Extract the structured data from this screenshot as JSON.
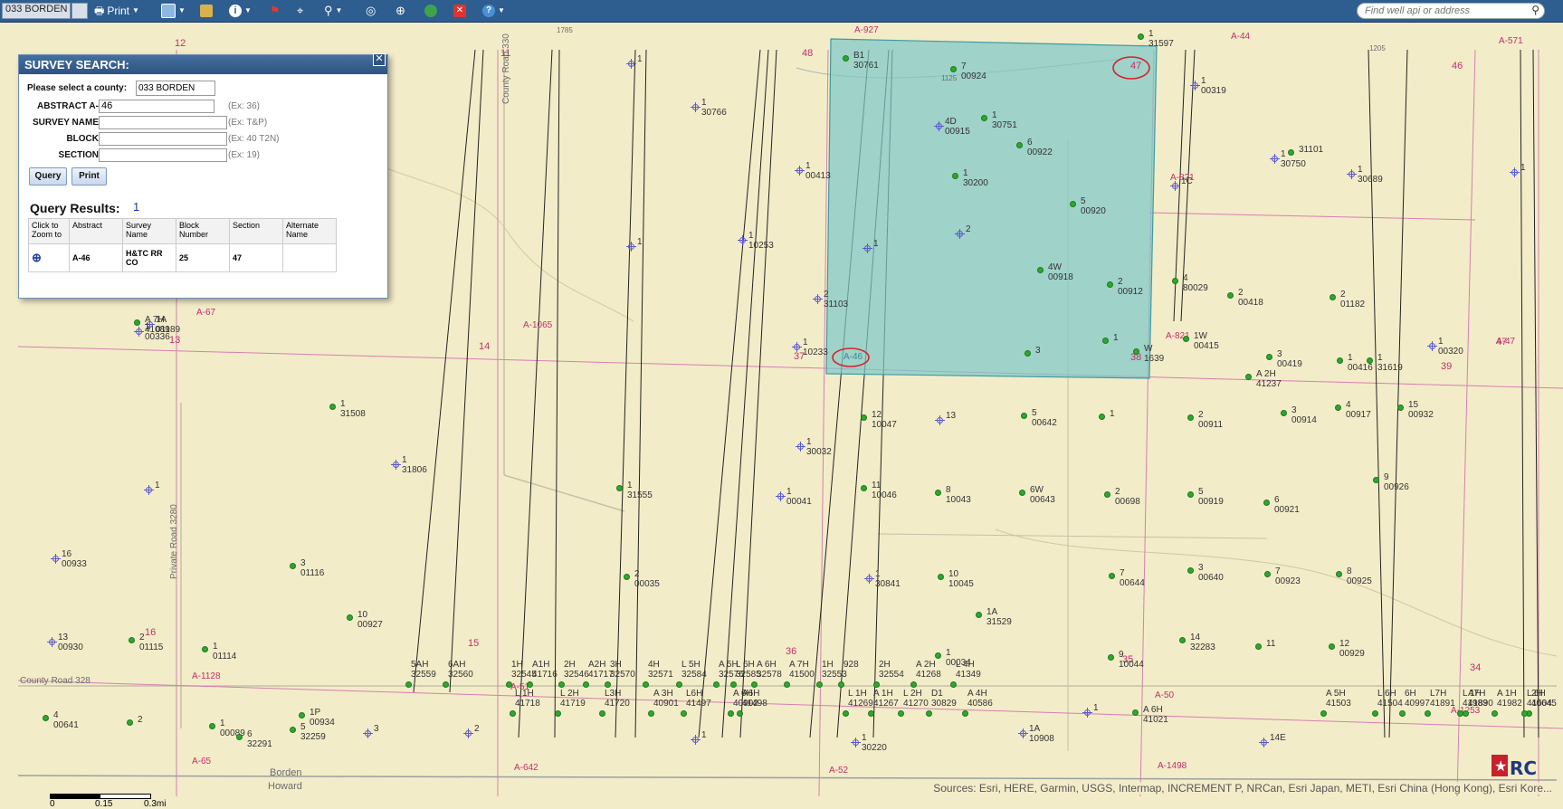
{
  "toolbar": {
    "county_label": "033 BORDEN",
    "print_label": "Print",
    "search_placeholder": "Find well api or address"
  },
  "panel": {
    "title": "SURVEY SEARCH:",
    "county_prompt": "Please select a county:",
    "county_value": "033 BORDEN",
    "fields": [
      {
        "label": "ABSTRACT A-",
        "value": "46",
        "example": "(Ex: 36)"
      },
      {
        "label": "SURVEY NAME",
        "value": "",
        "example": "(Ex: T&P)"
      },
      {
        "label": "BLOCK",
        "value": "",
        "example": "(Ex: 40 T2N)"
      },
      {
        "label": "SECTION",
        "value": "",
        "example": "(Ex: 19)"
      }
    ],
    "query_button": "Query",
    "print_button": "Print",
    "results_title": "Query Results:",
    "results_count": "1",
    "columns": [
      "Click to Zoom to",
      "Abstract",
      "Survey Name",
      "Block Number",
      "Section",
      "Alternate Name"
    ],
    "rows": [
      {
        "abstract": "A-46",
        "survey_name": "H&TC RR CO",
        "block": "25",
        "section": "47",
        "alternate": ""
      }
    ]
  },
  "map": {
    "highlight_color": "#7ec8c8",
    "road_labels": [
      "County Road 330",
      "Private Road 3280",
      "County Road 328",
      "1785",
      "1205",
      "1125"
    ],
    "county_labels": [
      "Borden",
      "Howard"
    ],
    "section_numbers": [
      "12",
      "11",
      "48",
      "46",
      "13",
      "14",
      "37",
      "38",
      "47",
      "39",
      "16",
      "15",
      "36",
      "35",
      "34",
      "47"
    ],
    "abstracts": [
      "A-927",
      "A-44",
      "A-571",
      "A-67",
      "A-1065",
      "A-821",
      "A-821",
      "A-47",
      "A-1128",
      "A-51",
      "A-50",
      "A-1253",
      "A-65",
      "A-642",
      "A-52",
      "A-1498",
      "A-46"
    ],
    "wells": [
      {
        "t": "x",
        "l": "1"
      },
      {
        "t": "x",
        "l": "1\n30766"
      },
      {
        "t": "x",
        "l": "1\n00413"
      },
      {
        "t": "x",
        "l": "1"
      },
      {
        "t": "x",
        "l": "1\n10253"
      },
      {
        "t": "x",
        "l": "2\n31103"
      },
      {
        "t": "x",
        "l": "1\n10233"
      },
      {
        "t": "d",
        "l": "B1\n30761"
      },
      {
        "t": "d",
        "l": "7\n00924"
      },
      {
        "t": "x",
        "l": "4D\n00915"
      },
      {
        "t": "d",
        "l": "1\n30751"
      },
      {
        "t": "d",
        "l": "6\n00922"
      },
      {
        "t": "d",
        "l": "1\n30200"
      },
      {
        "t": "d",
        "l": "5\n00920"
      },
      {
        "t": "x",
        "l": "2"
      },
      {
        "t": "x",
        "l": "1"
      },
      {
        "t": "d",
        "l": "4W\n00918"
      },
      {
        "t": "d",
        "l": "2\n00912"
      },
      {
        "t": "d",
        "l": "3"
      },
      {
        "t": "d",
        "l": "1"
      },
      {
        "t": "d",
        "l": "1\n31597"
      },
      {
        "t": "x",
        "l": "1\n00319"
      },
      {
        "t": "x",
        "l": "1\n30750"
      },
      {
        "t": "d",
        "l": "31101"
      },
      {
        "t": "x",
        "l": "1\n30689"
      },
      {
        "t": "x",
        "l": "1"
      },
      {
        "t": "x",
        "l": "1C"
      },
      {
        "t": "d",
        "l": "4\n80029"
      },
      {
        "t": "d",
        "l": "2\n00418"
      },
      {
        "t": "d",
        "l": "2\n01182"
      },
      {
        "t": "d",
        "l": "1W\n00415"
      },
      {
        "t": "d",
        "l": "W\n1639"
      },
      {
        "t": "d",
        "l": "3\n00419"
      },
      {
        "t": "d",
        "l": "1\n00416"
      },
      {
        "t": "d",
        "l": "1\n31619"
      },
      {
        "t": "x",
        "l": "1\n00320"
      },
      {
        "t": "d",
        "l": "A 2H\n41237"
      },
      {
        "t": "d",
        "l": "1\n31508"
      },
      {
        "t": "d",
        "l": "12\n10047"
      },
      {
        "t": "x",
        "l": "13"
      },
      {
        "t": "d",
        "l": "5\n00642"
      },
      {
        "t": "d",
        "l": "1"
      },
      {
        "t": "d",
        "l": "2\n00911"
      },
      {
        "t": "d",
        "l": "3\n00914"
      },
      {
        "t": "d",
        "l": "4\n00917"
      },
      {
        "t": "d",
        "l": "15\n00932"
      },
      {
        "t": "x",
        "l": "1\n30032"
      },
      {
        "t": "x",
        "l": "1\n31806"
      },
      {
        "t": "x",
        "l": "1"
      },
      {
        "t": "d",
        "l": "1\n31555"
      },
      {
        "t": "x",
        "l": "1\n00041"
      },
      {
        "t": "d",
        "l": "11\n10046"
      },
      {
        "t": "d",
        "l": "8\n10043"
      },
      {
        "t": "d",
        "l": "6W\n00643"
      },
      {
        "t": "d",
        "l": "2\n00698"
      },
      {
        "t": "d",
        "l": "5\n00919"
      },
      {
        "t": "d",
        "l": "6\n00921"
      },
      {
        "t": "d",
        "l": "9\n00926"
      },
      {
        "t": "x",
        "l": "16\n00933"
      },
      {
        "t": "d",
        "l": "3\n01116"
      },
      {
        "t": "d",
        "l": "2\n00035"
      },
      {
        "t": "x",
        "l": "1\n30841"
      },
      {
        "t": "d",
        "l": "10\n10045"
      },
      {
        "t": "d",
        "l": "7\n00644"
      },
      {
        "t": "d",
        "l": "3\n00640"
      },
      {
        "t": "d",
        "l": "7\n00923"
      },
      {
        "t": "d",
        "l": "8\n00925"
      },
      {
        "t": "d",
        "l": "10\n00927"
      },
      {
        "t": "d",
        "l": "1A\n31529"
      },
      {
        "t": "d",
        "l": "14\n32283"
      },
      {
        "t": "d",
        "l": "11"
      },
      {
        "t": "d",
        "l": "12\n00929"
      },
      {
        "t": "x",
        "l": "13\n00930"
      },
      {
        "t": "d",
        "l": "2\n01115"
      },
      {
        "t": "d",
        "l": "1\n01114"
      },
      {
        "t": "d",
        "l": "1\n00034"
      },
      {
        "t": "d",
        "l": "9\n10044"
      },
      {
        "t": "d",
        "l": "4\n00641"
      },
      {
        "t": "d",
        "l": "2"
      },
      {
        "t": "d",
        "l": "1\n00089"
      },
      {
        "t": "d",
        "l": "1P\n00934"
      },
      {
        "t": "d",
        "l": "6\n32291"
      },
      {
        "t": "d",
        "l": "5\n32259"
      },
      {
        "t": "x",
        "l": "3"
      },
      {
        "t": "x",
        "l": "2"
      },
      {
        "t": "x",
        "l": "1"
      },
      {
        "t": "x",
        "l": "1\n30220"
      },
      {
        "t": "x",
        "l": "1A\n10908"
      },
      {
        "t": "x",
        "l": "14E"
      },
      {
        "t": "x",
        "l": "1"
      },
      {
        "t": "d",
        "l": "A 6H\n41021"
      },
      {
        "t": "d",
        "l": "A 7H\n41089"
      },
      {
        "t": "x",
        "l": "1A\n01189"
      },
      {
        "t": "x",
        "l": "1\n00336"
      },
      {
        "t": "x",
        "l": "1AA"
      }
    ],
    "bottom_wells": [
      "5AH\n32559",
      "6AH\n32560",
      "1H\n32545",
      "A1H\n41716",
      "2H\n32546",
      "A2H\n41717",
      "3H\n32570",
      "4H\n32571",
      "L 5H\n32584",
      "A 5H\n32576",
      "L 6H\n32585",
      "A 6H\n32578",
      "A 7H\n41500",
      "1H\n32553",
      "2H\n32554",
      "A 2H\n41268",
      "L 4H\n41349",
      "L 1H\n41718",
      "L 2H\n41719",
      "L3H\n41720",
      "A 3H\n40901",
      "L6H\n41497",
      "A 6H\n40902",
      "A6H\n41498",
      "L 1H\n41269",
      "A 1H\n41267",
      "L 2H\n41270",
      "D1\n30829",
      "A 4H\n40586",
      "A 5H\n41503",
      "L 6H\n41504",
      "6H\n40997",
      "L7H\n41891",
      "A7H\n41890",
      "L 1H\n41983",
      "A 1H\n41982",
      "2H\n40645",
      "L 6H\n41504",
      "928"
    ]
  },
  "scale": {
    "labels": [
      "0",
      "0.15",
      "0.3mi"
    ]
  },
  "attribution": "Sources: Esri, HERE, Garmin, USGS, Intermap, INCREMENT P, NRCan, Esri Japan, METI, Esri China (Hong Kong), Esri Kore..."
}
